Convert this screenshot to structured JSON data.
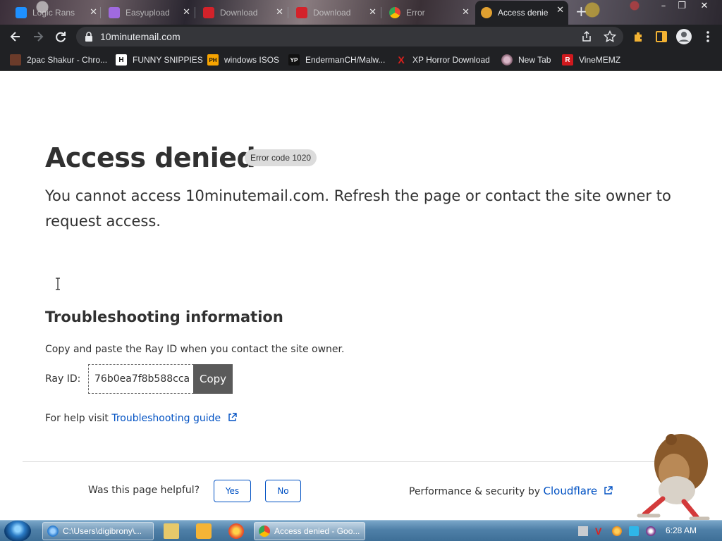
{
  "browser": {
    "tabs": [
      {
        "label": "Logic Rans",
        "active": false
      },
      {
        "label": "Easyupload",
        "active": false
      },
      {
        "label": "Download",
        "active": false
      },
      {
        "label": "Download",
        "active": false
      },
      {
        "label": "Error",
        "active": false
      },
      {
        "label": "Access denie",
        "active": true
      }
    ],
    "new_tab_symbol": "+",
    "url": "10minutemail.com"
  },
  "bookmarks": [
    {
      "label": "2pac Shakur - Chro...",
      "icon": "2pac-icon"
    },
    {
      "label": "FUNNY SNIPPIES",
      "icon": "H"
    },
    {
      "label": "windows ISOS",
      "icon": "PH"
    },
    {
      "label": "EndermanCH/Malw...",
      "icon": "YP"
    },
    {
      "label": "XP Horror Download",
      "icon": "X"
    },
    {
      "label": "New Tab",
      "icon": "globe-icon"
    },
    {
      "label": "VineMEMZ",
      "icon": "R"
    }
  ],
  "page": {
    "heading": "Access denied",
    "error_code": "Error code 1020",
    "description": "You cannot access 10minutemail.com. Refresh the page or contact the site owner to request access.",
    "troubleshooting_heading": "Troubleshooting information",
    "troubleshooting_text": "Copy and paste the Ray ID when you contact the site owner.",
    "ray_label": "Ray ID:",
    "ray_id": "76b0ea7f8b588cca",
    "copy_label": "Copy",
    "help_prefix": "For help visit",
    "help_link": "Troubleshooting guide",
    "helpful_question": "Was this page helpful?",
    "yes_label": "Yes",
    "no_label": "No",
    "perf_prefix": "Performance & security by",
    "perf_link": "Cloudflare"
  },
  "taskbar": {
    "tasks": [
      {
        "label": "C:\\Users\\digibrony\\..."
      },
      {
        "label": "Access denied - Goo..."
      }
    ],
    "clock": "6:28 AM"
  },
  "colors": {
    "link": "#0051c3",
    "text": "#313131",
    "copy_button": "#5a5a5a",
    "chrome_dark": "#202124"
  }
}
